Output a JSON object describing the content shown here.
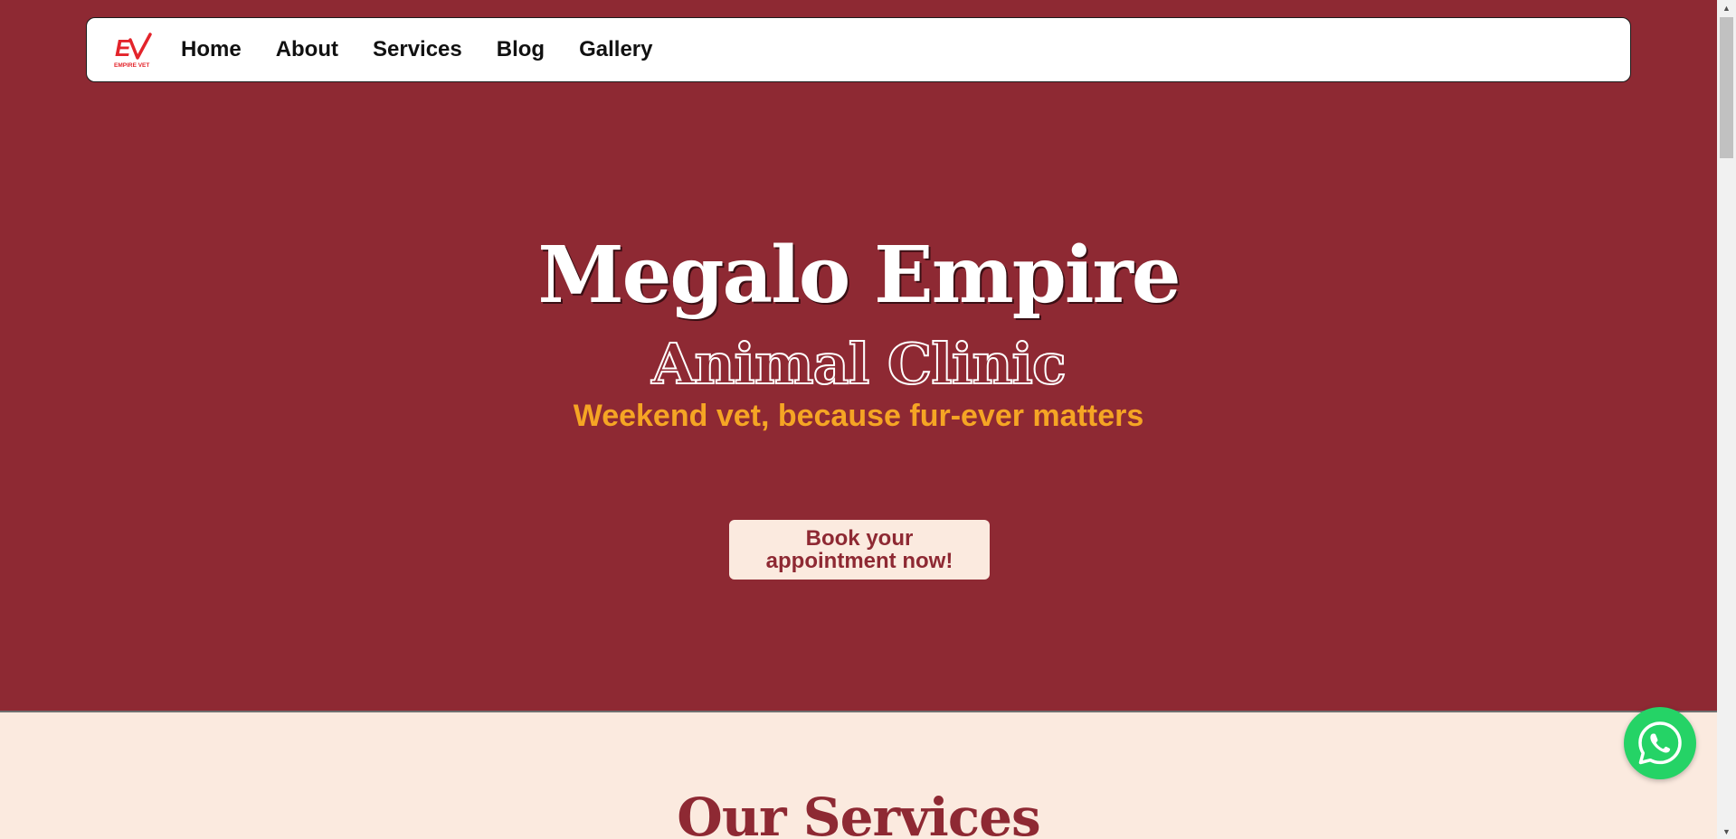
{
  "brand": {
    "logo_text": "EV",
    "logo_subtext": "EMPIRE VET",
    "logo_color": "#e3242b"
  },
  "nav": {
    "items": [
      {
        "label": "Home"
      },
      {
        "label": "About"
      },
      {
        "label": "Services"
      },
      {
        "label": "Blog"
      },
      {
        "label": "Gallery"
      }
    ]
  },
  "hero": {
    "title": "Megalo Empire",
    "subtitle": "Animal Clinic",
    "tagline": "Weekend vet, because fur-ever matters",
    "cta_label": "Book your appointment now!",
    "background_color": "#8e2933",
    "accent_color": "#f5a524"
  },
  "services": {
    "heading": "Our Services"
  },
  "whatsapp": {
    "icon": "whatsapp-icon",
    "color": "#25d366"
  }
}
